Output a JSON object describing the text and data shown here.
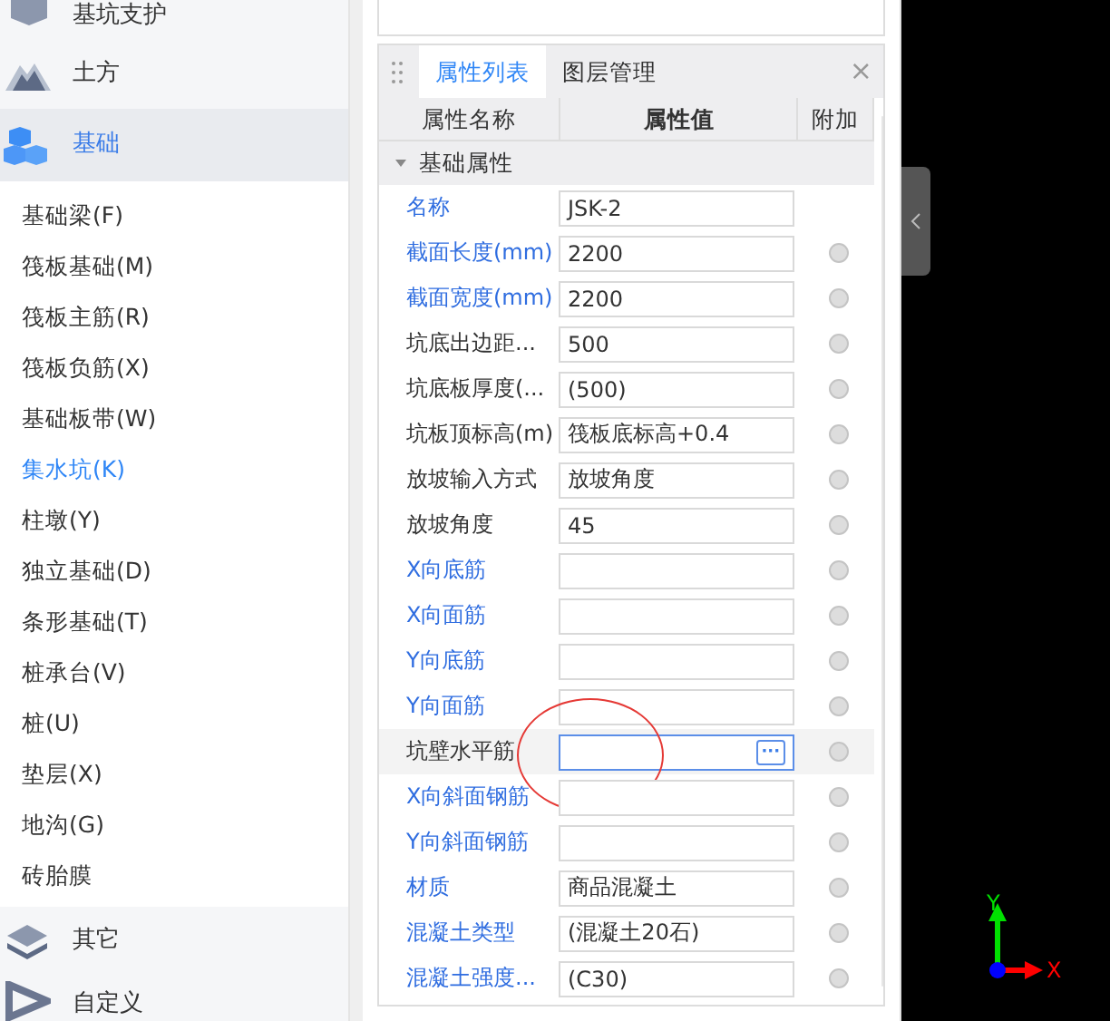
{
  "sidebar": {
    "categories_top": [
      {
        "label": "基坑支护",
        "selected": false
      },
      {
        "label": "土方",
        "selected": false
      },
      {
        "label": "基础",
        "selected": true
      }
    ],
    "items": [
      {
        "label": "基础梁(F)",
        "selected": false
      },
      {
        "label": "筏板基础(M)",
        "selected": false
      },
      {
        "label": "筏板主筋(R)",
        "selected": false
      },
      {
        "label": "筏板负筋(X)",
        "selected": false
      },
      {
        "label": "基础板带(W)",
        "selected": false
      },
      {
        "label": "集水坑(K)",
        "selected": true
      },
      {
        "label": "柱墩(Y)",
        "selected": false
      },
      {
        "label": "独立基础(D)",
        "selected": false
      },
      {
        "label": "条形基础(T)",
        "selected": false
      },
      {
        "label": "桩承台(V)",
        "selected": false
      },
      {
        "label": "桩(U)",
        "selected": false
      },
      {
        "label": "垫层(X)",
        "selected": false
      },
      {
        "label": "地沟(G)",
        "selected": false
      },
      {
        "label": "砖胎膜",
        "selected": false
      }
    ],
    "categories_bottom": [
      {
        "label": "其它",
        "selected": false
      },
      {
        "label": "自定义",
        "selected": false
      }
    ]
  },
  "panel": {
    "tabs": [
      {
        "label": "属性列表",
        "selected": true
      },
      {
        "label": "图层管理",
        "selected": false
      }
    ],
    "close": "×",
    "columns": [
      "属性名称",
      "属性值",
      "附加"
    ],
    "group": {
      "label": "基础属性",
      "expanded": true
    },
    "rows": [
      {
        "name": "名称",
        "public": true,
        "value": "JSK-2",
        "attach_option": false,
        "selected": false
      },
      {
        "name": "截面长度(mm)",
        "public": true,
        "value": "2200",
        "attach_option": true,
        "selected": false
      },
      {
        "name": "截面宽度(mm)",
        "public": true,
        "value": "2200",
        "attach_option": true,
        "selected": false
      },
      {
        "name": "坑底出边距...",
        "public": false,
        "value": "500",
        "attach_option": true,
        "selected": false
      },
      {
        "name": "坑底板厚度(...",
        "public": false,
        "value": "(500)",
        "attach_option": true,
        "selected": false
      },
      {
        "name": "坑板顶标高(m)",
        "public": false,
        "value": "筏板底标高+0.4",
        "attach_option": true,
        "selected": false
      },
      {
        "name": "放坡输入方式",
        "public": false,
        "value": "放坡角度",
        "attach_option": true,
        "selected": false
      },
      {
        "name": "放坡角度",
        "public": false,
        "value": "45",
        "attach_option": true,
        "selected": false
      },
      {
        "name": "X向底筋",
        "public": true,
        "value": "",
        "attach_option": true,
        "selected": false
      },
      {
        "name": "X向面筋",
        "public": true,
        "value": "",
        "attach_option": true,
        "selected": false
      },
      {
        "name": "Y向底筋",
        "public": true,
        "value": "",
        "attach_option": true,
        "selected": false
      },
      {
        "name": "Y向面筋",
        "public": true,
        "value": "",
        "attach_option": true,
        "selected": false
      },
      {
        "name": "坑壁水平筋",
        "public": false,
        "value": "",
        "attach_option": true,
        "selected": true,
        "ellipsis": "···"
      },
      {
        "name": "X向斜面钢筋",
        "public": true,
        "value": "",
        "attach_option": true,
        "selected": false
      },
      {
        "name": "Y向斜面钢筋",
        "public": true,
        "value": "",
        "attach_option": true,
        "selected": false
      },
      {
        "name": "材质",
        "public": true,
        "value": "商品混凝土",
        "attach_option": true,
        "selected": false
      },
      {
        "name": "混凝土类型",
        "public": true,
        "value": "(混凝土20石)",
        "attach_option": true,
        "selected": false
      },
      {
        "name": "混凝土强度...",
        "public": true,
        "value": "(C30)",
        "attach_option": true,
        "selected": false
      }
    ]
  },
  "canvas": {
    "axis": {
      "x_label": "X",
      "y_label": "Y"
    }
  }
}
